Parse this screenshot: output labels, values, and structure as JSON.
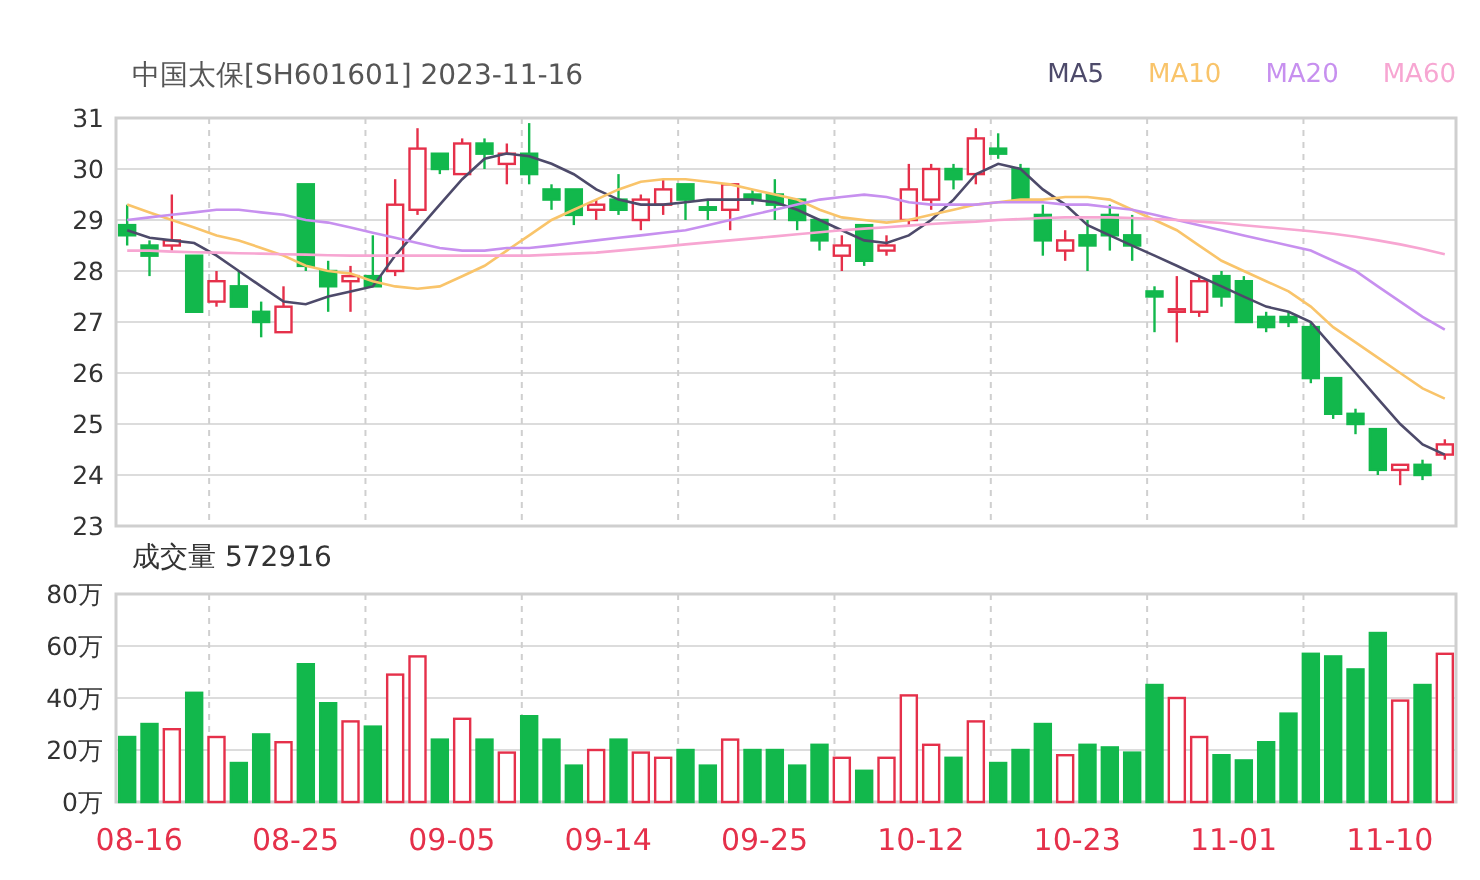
{
  "title": "中国太保[SH601601] 2023-11-16",
  "price_chart": {
    "chart_data": {
      "type": "candlestick",
      "grid": true,
      "ylim": [
        23,
        31
      ],
      "yticks": [
        23,
        24,
        25,
        26,
        27,
        28,
        29,
        30,
        31
      ],
      "categories": [
        null,
        null,
        null,
        null,
        null,
        null,
        null,
        null,
        null,
        null,
        null,
        null,
        null,
        null,
        null,
        null,
        null,
        null,
        null,
        null,
        null,
        null,
        null,
        null,
        null,
        null,
        null,
        null,
        null,
        null,
        null,
        null,
        null,
        null,
        null,
        null,
        null,
        null,
        null,
        null,
        null,
        null,
        null,
        null,
        null,
        null,
        null,
        null,
        null,
        null,
        null,
        null,
        null,
        null,
        null,
        null,
        null,
        null,
        null,
        null
      ],
      "ohlc": [
        [
          28.9,
          29.3,
          28.5,
          28.7
        ],
        [
          28.5,
          28.6,
          27.9,
          28.3
        ],
        [
          28.5,
          29.5,
          28.4,
          28.6
        ],
        [
          28.3,
          28.3,
          27.2,
          27.2
        ],
        [
          27.4,
          28.0,
          27.3,
          27.8
        ],
        [
          27.7,
          28.0,
          27.3,
          27.3
        ],
        [
          27.2,
          27.4,
          26.7,
          27.0
        ],
        [
          26.8,
          27.7,
          26.8,
          27.3
        ],
        [
          29.7,
          29.7,
          28.0,
          28.1
        ],
        [
          28.0,
          28.2,
          27.2,
          27.7
        ],
        [
          27.8,
          28.1,
          27.2,
          27.9
        ],
        [
          27.9,
          28.7,
          27.7,
          27.7
        ],
        [
          28.0,
          29.8,
          27.9,
          29.3
        ],
        [
          29.2,
          30.8,
          29.1,
          30.4
        ],
        [
          30.3,
          30.3,
          29.9,
          30.0
        ],
        [
          29.9,
          30.6,
          29.9,
          30.5
        ],
        [
          30.5,
          30.6,
          30.0,
          30.3
        ],
        [
          30.1,
          30.5,
          29.7,
          30.3
        ],
        [
          30.3,
          30.9,
          29.7,
          29.9
        ],
        [
          29.6,
          29.7,
          29.2,
          29.4
        ],
        [
          29.6,
          29.6,
          28.9,
          29.1
        ],
        [
          29.2,
          29.4,
          29.0,
          29.3
        ],
        [
          29.4,
          29.9,
          29.1,
          29.2
        ],
        [
          29.0,
          29.5,
          28.8,
          29.4
        ],
        [
          29.3,
          29.8,
          29.1,
          29.6
        ],
        [
          29.7,
          29.7,
          29.0,
          29.4
        ],
        [
          29.25,
          29.4,
          29.0,
          29.2
        ],
        [
          29.2,
          29.7,
          28.8,
          29.7
        ],
        [
          29.5,
          29.6,
          29.3,
          29.4
        ],
        [
          29.5,
          29.8,
          29.0,
          29.3
        ],
        [
          29.4,
          29.4,
          28.8,
          29.0
        ],
        [
          29.0,
          29.0,
          28.4,
          28.6
        ],
        [
          28.3,
          28.7,
          28.0,
          28.5
        ],
        [
          28.9,
          28.9,
          28.1,
          28.2
        ],
        [
          28.4,
          28.7,
          28.3,
          28.5
        ],
        [
          29.0,
          30.1,
          28.9,
          29.6
        ],
        [
          29.4,
          30.1,
          29.2,
          30.0
        ],
        [
          30.0,
          30.1,
          29.6,
          29.8
        ],
        [
          29.9,
          30.8,
          29.7,
          30.6
        ],
        [
          30.4,
          30.7,
          30.2,
          30.3
        ],
        [
          30.0,
          30.1,
          29.4,
          29.4
        ],
        [
          29.1,
          29.3,
          28.3,
          28.6
        ],
        [
          28.4,
          28.8,
          28.2,
          28.6
        ],
        [
          28.7,
          29.0,
          28.0,
          28.5
        ],
        [
          29.1,
          29.3,
          28.4,
          28.7
        ],
        [
          28.7,
          29.1,
          28.2,
          28.5
        ],
        [
          27.6,
          27.7,
          26.8,
          27.5
        ],
        [
          27.2,
          27.9,
          26.6,
          27.25
        ],
        [
          27.2,
          27.9,
          27.1,
          27.8
        ],
        [
          27.9,
          28.0,
          27.3,
          27.5
        ],
        [
          27.8,
          27.9,
          27.0,
          27.0
        ],
        [
          27.1,
          27.2,
          26.8,
          26.9
        ],
        [
          27.1,
          27.2,
          26.9,
          27.0
        ],
        [
          26.9,
          27.0,
          25.8,
          25.9
        ],
        [
          25.9,
          25.9,
          25.1,
          25.2
        ],
        [
          25.2,
          25.3,
          24.8,
          25.0
        ],
        [
          24.9,
          24.9,
          24.0,
          24.1
        ],
        [
          24.1,
          24.2,
          23.8,
          24.2
        ],
        [
          24.2,
          24.3,
          23.9,
          24.0
        ],
        [
          24.4,
          24.7,
          24.3,
          24.6
        ]
      ],
      "series": [
        {
          "name": "MA5",
          "type": "line",
          "color": "#4d4a6a",
          "values": [
            28.8,
            28.65,
            28.6,
            28.55,
            28.3,
            28.0,
            27.7,
            27.4,
            27.35,
            27.5,
            27.6,
            27.7,
            28.3,
            28.8,
            29.3,
            29.8,
            30.2,
            30.3,
            30.25,
            30.1,
            29.9,
            29.6,
            29.4,
            29.3,
            29.3,
            29.35,
            29.4,
            29.4,
            29.4,
            29.35,
            29.2,
            29.0,
            28.8,
            28.6,
            28.55,
            28.7,
            29.0,
            29.4,
            29.9,
            30.1,
            30.0,
            29.6,
            29.3,
            28.9,
            28.7,
            28.5,
            28.3,
            28.1,
            27.9,
            27.7,
            27.5,
            27.3,
            27.2,
            27.0,
            26.5,
            26.0,
            25.5,
            25.0,
            24.6,
            24.4
          ]
        },
        {
          "name": "MA10",
          "type": "line",
          "color": "#f9c46a",
          "values": [
            29.3,
            29.15,
            29.0,
            28.85,
            28.7,
            28.6,
            28.45,
            28.3,
            28.1,
            28.0,
            27.95,
            27.8,
            27.7,
            27.65,
            27.7,
            27.9,
            28.1,
            28.4,
            28.7,
            29.0,
            29.2,
            29.4,
            29.6,
            29.75,
            29.8,
            29.8,
            29.75,
            29.7,
            29.6,
            29.5,
            29.4,
            29.2,
            29.05,
            29.0,
            28.95,
            29.0,
            29.1,
            29.2,
            29.3,
            29.35,
            29.4,
            29.4,
            29.45,
            29.45,
            29.4,
            29.2,
            29.0,
            28.8,
            28.5,
            28.2,
            28.0,
            27.8,
            27.6,
            27.3,
            26.9,
            26.6,
            26.3,
            26.0,
            25.7,
            25.5
          ]
        },
        {
          "name": "MA20",
          "type": "line",
          "color": "#c790ef",
          "values": [
            29.0,
            29.05,
            29.1,
            29.15,
            29.2,
            29.2,
            29.15,
            29.1,
            29.0,
            28.95,
            28.85,
            28.75,
            28.65,
            28.55,
            28.45,
            28.4,
            28.4,
            28.45,
            28.45,
            28.5,
            28.55,
            28.6,
            28.65,
            28.7,
            28.75,
            28.8,
            28.9,
            29.0,
            29.1,
            29.2,
            29.3,
            29.4,
            29.45,
            29.5,
            29.45,
            29.35,
            29.3,
            29.3,
            29.3,
            29.35,
            29.35,
            29.35,
            29.3,
            29.3,
            29.25,
            29.2,
            29.1,
            29.0,
            28.9,
            28.8,
            28.7,
            28.6,
            28.5,
            28.4,
            28.2,
            28.0,
            27.7,
            27.4,
            27.1,
            26.85
          ]
        },
        {
          "name": "MA60",
          "type": "line",
          "color": "#f7a6d2",
          "values": [
            28.4,
            28.4,
            28.38,
            28.37,
            28.36,
            28.35,
            28.34,
            28.33,
            28.32,
            28.31,
            28.3,
            28.3,
            28.3,
            28.3,
            28.3,
            28.3,
            28.3,
            28.3,
            28.3,
            28.32,
            28.34,
            28.36,
            28.4,
            28.44,
            28.48,
            28.52,
            28.56,
            28.6,
            28.64,
            28.68,
            28.72,
            28.76,
            28.8,
            28.83,
            28.86,
            28.89,
            28.92,
            28.95,
            28.97,
            29.0,
            29.02,
            29.04,
            29.05,
            29.05,
            29.05,
            29.04,
            29.02,
            29.0,
            28.97,
            28.94,
            28.9,
            28.86,
            28.82,
            28.78,
            28.73,
            28.67,
            28.6,
            28.52,
            28.43,
            28.33
          ]
        }
      ]
    }
  },
  "volume_title": "成交量 572916",
  "volume_chart": {
    "chart_data": {
      "type": "bar",
      "grid": true,
      "ylim": [
        0,
        80
      ],
      "yticks": [
        {
          "value": 0,
          "label": "0万"
        },
        {
          "value": 20,
          "label": "20万"
        },
        {
          "value": 40,
          "label": "40万"
        },
        {
          "value": 60,
          "label": "60万"
        },
        {
          "value": 80,
          "label": "80万"
        }
      ],
      "categories": [
        "08-16",
        null,
        null,
        null,
        null,
        null,
        null,
        "08-25",
        null,
        null,
        null,
        null,
        null,
        null,
        "09-05",
        null,
        null,
        null,
        null,
        null,
        null,
        "09-14",
        null,
        null,
        null,
        null,
        null,
        null,
        "09-25",
        null,
        null,
        null,
        null,
        null,
        null,
        "10-12",
        null,
        null,
        null,
        null,
        null,
        null,
        "10-23",
        null,
        null,
        null,
        null,
        null,
        null,
        "11-01",
        null,
        null,
        null,
        null,
        null,
        null,
        "11-10",
        null,
        null,
        null
      ],
      "series": [
        {
          "values": [
            25,
            30,
            28,
            42,
            25,
            15,
            26,
            23,
            53,
            38,
            31,
            29,
            49,
            56,
            24,
            32,
            24,
            19,
            33,
            24,
            14,
            20,
            24,
            19,
            17,
            20,
            14,
            24,
            20,
            20,
            14,
            22,
            17,
            12,
            17,
            41,
            22,
            17,
            31,
            15,
            20,
            30,
            18,
            22,
            21,
            19,
            45,
            40,
            25,
            18,
            16,
            23,
            34,
            57,
            56,
            51,
            65,
            39,
            45,
            57
          ]
        }
      ]
    }
  }
}
